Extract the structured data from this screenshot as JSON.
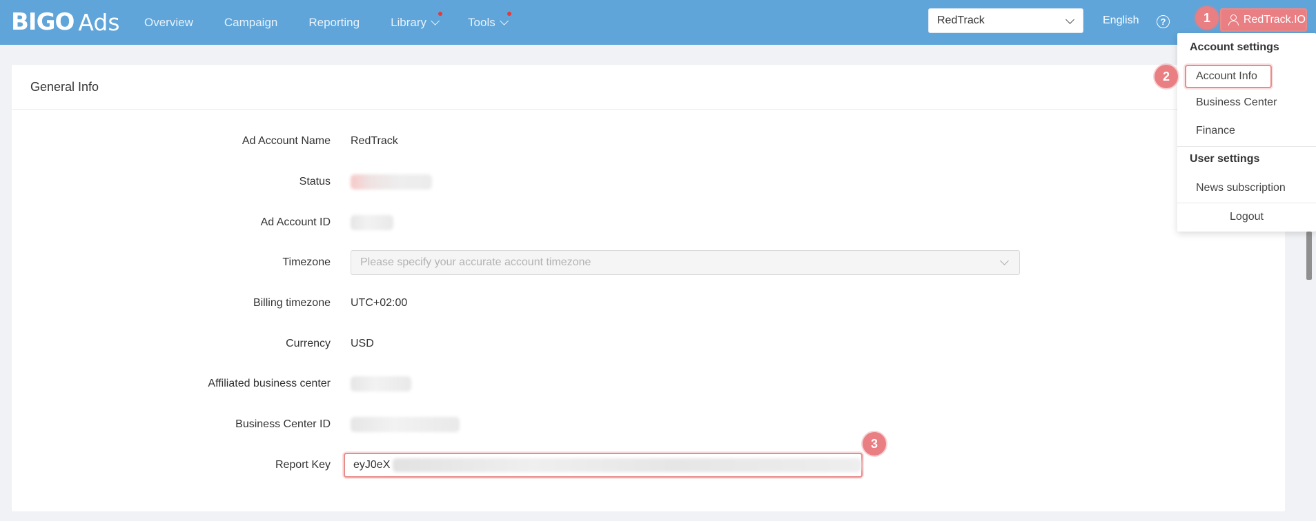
{
  "brand": {
    "logo_main": "BIGO",
    "logo_sub": "Ads"
  },
  "nav": {
    "items": [
      {
        "label": "Overview",
        "has_chevron": false,
        "has_dot": false
      },
      {
        "label": "Campaign",
        "has_chevron": false,
        "has_dot": false
      },
      {
        "label": "Reporting",
        "has_chevron": false,
        "has_dot": false
      },
      {
        "label": "Library",
        "has_chevron": true,
        "has_dot": true
      },
      {
        "label": "Tools",
        "has_chevron": true,
        "has_dot": true
      }
    ]
  },
  "header": {
    "account_selector": "RedTrack",
    "language": "English",
    "help_glyph": "?",
    "user_name": "RedTrack.IO"
  },
  "annotations": {
    "step1": "1",
    "step2": "2",
    "step3": "3"
  },
  "dropdown": {
    "account_settings_heading": "Account settings",
    "account_info": "Account Info",
    "business_center": "Business Center",
    "finance": "Finance",
    "user_settings_heading": "User settings",
    "news_subscription": "News subscription",
    "logout": "Logout"
  },
  "general_info": {
    "title": "General Info",
    "fields": {
      "ad_account_name_label": "Ad Account Name",
      "ad_account_name_value": "RedTrack",
      "status_label": "Status",
      "ad_account_id_label": "Ad Account ID",
      "timezone_label": "Timezone",
      "timezone_placeholder": "Please specify your accurate account timezone",
      "billing_timezone_label": "Billing timezone",
      "billing_timezone_value": "UTC+02:00",
      "currency_label": "Currency",
      "currency_value": "USD",
      "affiliated_bc_label": "Affiliated business center",
      "bc_id_label": "Business Center ID",
      "report_key_label": "Report Key",
      "report_key_visible": "eyJ0eX"
    }
  },
  "colors": {
    "topbar": "#5fa5d9",
    "highlight": "#e97e83",
    "page_bg": "#f0f2f5"
  }
}
